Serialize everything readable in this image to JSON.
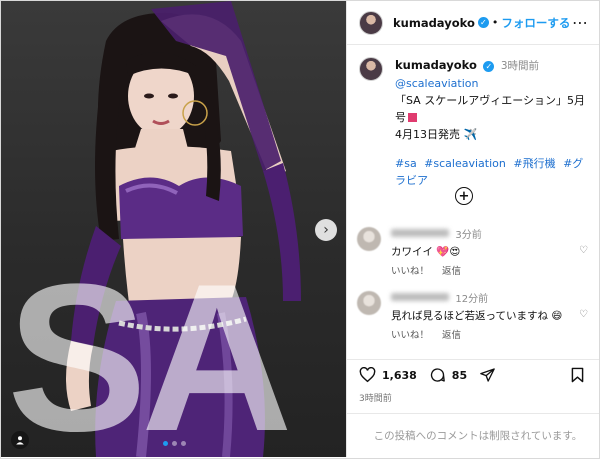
{
  "media": {
    "overlay_text": "SA",
    "carousel_pages": 3,
    "carousel_current": 1,
    "next_icon": "chevron-right-icon",
    "tag_icon": "person-tag-icon"
  },
  "header": {
    "username": "kumadayoko",
    "separator": "•",
    "follow_label": "フォローする",
    "more_icon": "more-icon"
  },
  "post": {
    "username": "kumadayoko",
    "time": "3時間前",
    "mention": "@scaleaviation",
    "line1": "「SA スケールアヴィエーション」5月号",
    "line2": "4月13日発売",
    "line2_emoji": "✈️",
    "hashtags": "#sa #scaleaviation #飛行機 #グラビア"
  },
  "comments": [
    {
      "time": "3分前",
      "text": "カワイイ",
      "emoji": "💖😍",
      "like_label": "いいね！",
      "reply_label": "返信"
    },
    {
      "time": "12分前",
      "text": "見れば見るほど若返っていますね",
      "emoji": "😄",
      "like_label": "いいね！",
      "reply_label": "返信"
    }
  ],
  "actions": {
    "likes": "1,638",
    "comments": "85",
    "posted_ago": "3時間前"
  },
  "footer": {
    "closed_text": "この投稿へのコメントは制限されています。"
  },
  "colors": {
    "accent": "#1d9bf0",
    "link": "#1d6fcf"
  }
}
